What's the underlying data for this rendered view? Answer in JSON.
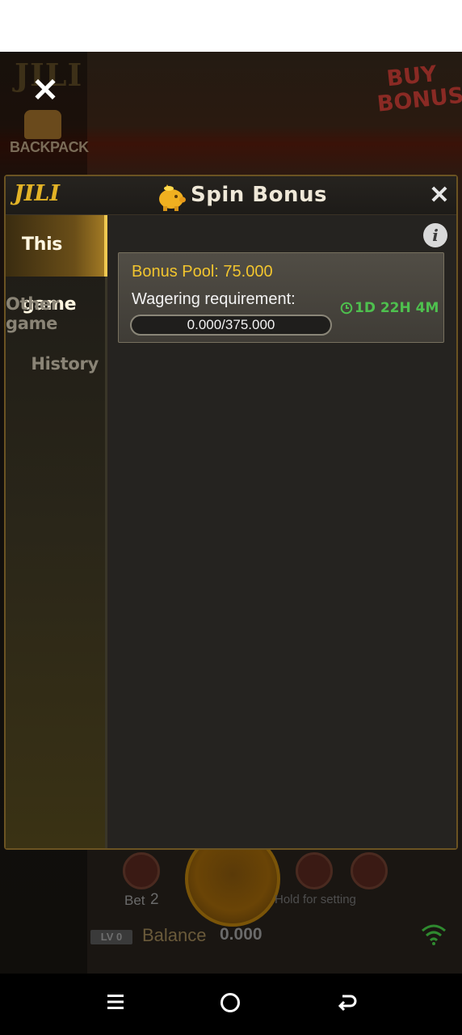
{
  "background_game": {
    "backpack_label": "BACKPACK",
    "buy_bonus_line1": "BUY",
    "buy_bonus_line2": "BONUS",
    "bet_label": "Bet",
    "bet_value": "2",
    "hold_label": "Hold for setting",
    "level_badge": "LV 0",
    "balance_label": "Balance",
    "balance_value": "0.000"
  },
  "modal": {
    "logo": "JILI",
    "title": "Spin Bonus",
    "close_icon": "close-icon",
    "nav": {
      "items": [
        {
          "label": "This game",
          "active": true
        },
        {
          "label": "Other game",
          "active": false
        },
        {
          "label": "History",
          "active": false
        }
      ]
    },
    "info_glyph": "i",
    "bonus_card": {
      "pool_label": "Bonus Pool: 75.000",
      "wager_label": "Wagering requirement:",
      "progress_text": "0.000/375.000",
      "progress_fraction": 0,
      "timer": "1D 22H 4M"
    }
  },
  "colors": {
    "accent_gold": "#f2c52e",
    "timer_green": "#4ec04e",
    "modal_bg": "#272320"
  },
  "icons": [
    "close-icon",
    "backpack-icon",
    "piggy-bank-icon",
    "info-icon",
    "clock-icon",
    "wifi-icon",
    "menu-icon",
    "home-icon",
    "back-icon"
  ]
}
